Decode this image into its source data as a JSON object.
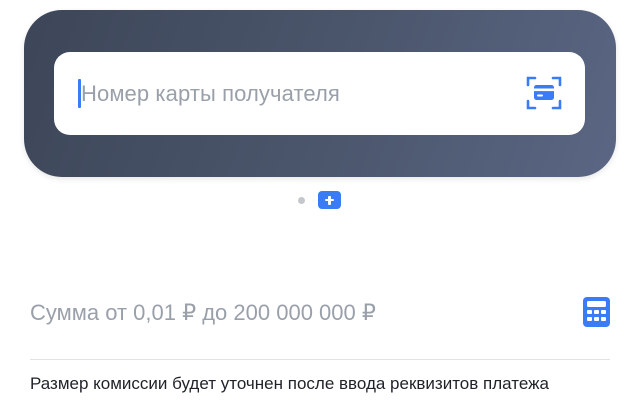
{
  "card_panel": {
    "card_number_placeholder": "Номер карты получателя",
    "scan_icon": "card-scan-icon"
  },
  "pager": {
    "add_icon": "plus-icon"
  },
  "amount": {
    "placeholder": "Сумма от 0,01 ₽ до 200 000 000 ₽",
    "calculator_icon": "calculator-icon"
  },
  "commission_note": "Размер комиссии будет уточнен после ввода реквизитов платежа",
  "colors": {
    "accent": "#3a7bf6",
    "panel_dark": "#3d4658",
    "placeholder": "#9aa0aa"
  }
}
